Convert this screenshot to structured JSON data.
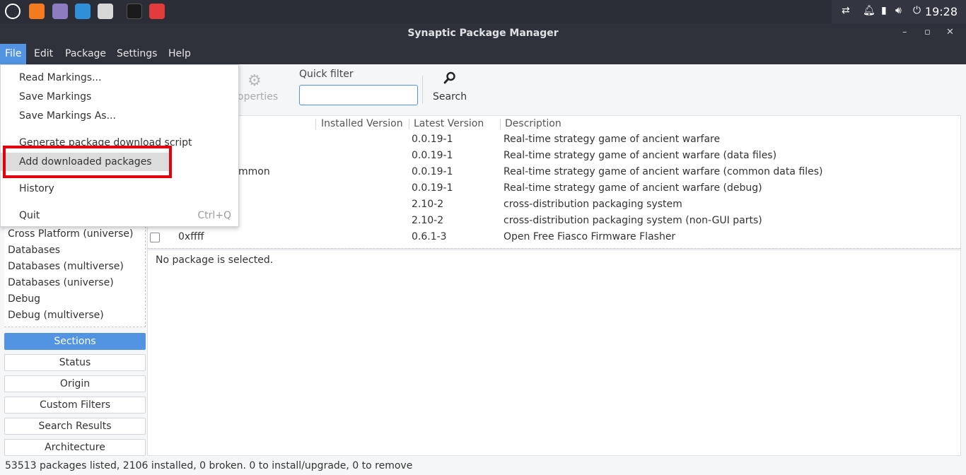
{
  "system_panel": {
    "clock": "19:28",
    "colors": {
      "panel_bg": "#2b2e36",
      "accent": "#5294e2"
    },
    "launchers": [
      {
        "icon": "app-menu-icon",
        "color": "#ffffff"
      },
      {
        "icon": "firefox-icon",
        "color": "#f47a20"
      },
      {
        "icon": "files-icon",
        "color": "#8e7cc3"
      },
      {
        "icon": "text-editor-icon",
        "color": "#2f8fd8"
      },
      {
        "icon": "screenshot-icon",
        "color": "#d7d7d7"
      },
      {
        "icon": "terminal-icon",
        "color": "#1b1b1b"
      },
      {
        "icon": "synaptic-icon",
        "color": "#e23b3b"
      }
    ],
    "tray_icons": [
      "network-icon",
      "notification-bell-icon",
      "battery-icon",
      "volume-icon",
      "power-icon"
    ]
  },
  "window": {
    "title": "Synaptic Package Manager"
  },
  "menubar": {
    "file": "File",
    "edit": "Edit",
    "package": "Package",
    "settings": "Settings",
    "help": "Help"
  },
  "file_menu": {
    "read_markings": "Read Markings...",
    "save_markings": "Save Markings",
    "save_markings_as": "Save Markings As...",
    "generate_script": "Generate package download script",
    "add_downloaded": "Add downloaded packages",
    "history": "History",
    "quit": "Quit",
    "quit_accel": "Ctrl+Q"
  },
  "toolbar": {
    "properties_label": "operties",
    "quick_filter_label": "Quick filter",
    "quick_filter_value": "",
    "search_label": "Search"
  },
  "sections_list": [
    "Cross Platform (universe)",
    "Databases",
    "Databases (multiverse)",
    "Databases (universe)",
    "Debug",
    "Debug (multiverse)"
  ],
  "filter_buttons": {
    "sections": "Sections",
    "status": "Status",
    "origin": "Origin",
    "custom_filters": "Custom Filters",
    "search_results": "Search Results",
    "architecture": "Architecture"
  },
  "table": {
    "headers": {
      "installed": "Installed Version",
      "latest": "Latest Version",
      "description": "Description"
    },
    "rows": [
      {
        "name": "",
        "latest": "0.0.19-1",
        "description": "Real-time strategy game of ancient warfare"
      },
      {
        "name": "",
        "latest": "0.0.19-1",
        "description": "Real-time strategy game of ancient warfare (data files)"
      },
      {
        "name": "mmon",
        "latest": "0.0.19-1",
        "description": "Real-time strategy game of ancient warfare (common data files)"
      },
      {
        "name": "",
        "latest": "0.0.19-1",
        "description": "Real-time strategy game of ancient warfare (debug)"
      },
      {
        "name": "",
        "latest": "2.10-2",
        "description": "cross-distribution packaging system"
      },
      {
        "name": "",
        "latest": "2.10-2",
        "description": "cross-distribution packaging system (non-GUI parts)"
      },
      {
        "name": "0xffff",
        "latest": "0.6.1-3",
        "description": "Open Free Fiasco Firmware Flasher"
      }
    ]
  },
  "details": {
    "text": "No package is selected."
  },
  "statusbar": {
    "text": "53513 packages listed, 2106 installed, 0 broken. 0 to install/upgrade, 0 to remove"
  }
}
